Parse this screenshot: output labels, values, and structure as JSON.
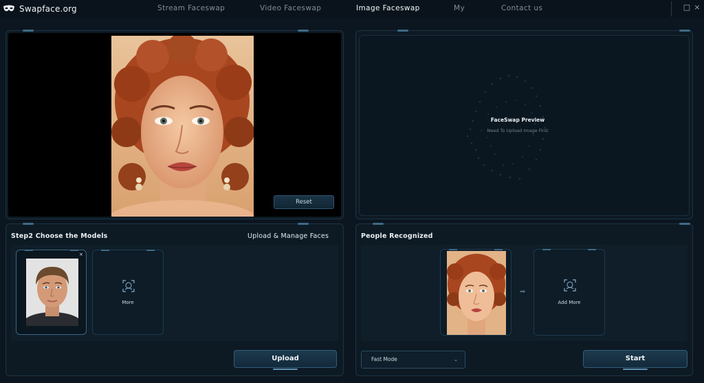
{
  "app": {
    "brand": "Swapface.org"
  },
  "nav": [
    {
      "label": "Stream Faceswap",
      "active": false
    },
    {
      "label": "Video Faceswap",
      "active": false
    },
    {
      "label": "Image Faceswap",
      "active": true
    },
    {
      "label": "My",
      "active": false
    },
    {
      "label": "Contact us",
      "active": false
    }
  ],
  "window_controls": {
    "maximize": "□",
    "close": "×"
  },
  "image_panel": {
    "reset_label": "Reset"
  },
  "preview": {
    "title": "FaceSwap Preview",
    "subtitle": "Need To Upload Image First"
  },
  "models": {
    "title": "Step2 Choose the Models",
    "manage_label": "Upload & Manage Faces",
    "close_icon": "×",
    "more_label": "More",
    "upload_label": "Upload"
  },
  "faces": {
    "title": "People Recognized",
    "add_more_label": "Add More",
    "mode_value": "Fast Mode",
    "start_label": "Start",
    "arrow": "➡"
  },
  "icons": {
    "brand": "mask-icon",
    "face-scan": "face-scan-icon",
    "chevron": "chevron-down-icon"
  },
  "colors": {
    "background": "#0c1620",
    "panel": "#0d1a24",
    "border": "#1d3344",
    "accent": "#3f6a86",
    "text": "#e9eff3",
    "muted": "#7f8e9a"
  }
}
